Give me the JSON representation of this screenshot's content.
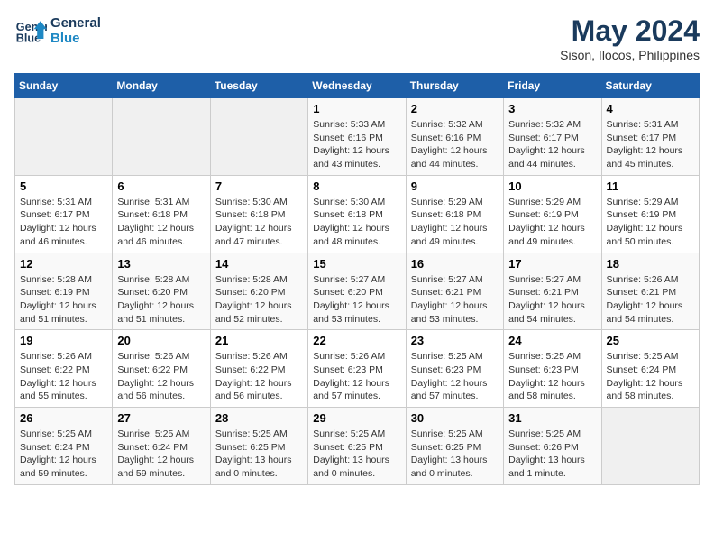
{
  "header": {
    "logo_line1": "General",
    "logo_line2": "Blue",
    "month": "May 2024",
    "location": "Sison, Ilocos, Philippines"
  },
  "weekdays": [
    "Sunday",
    "Monday",
    "Tuesday",
    "Wednesday",
    "Thursday",
    "Friday",
    "Saturday"
  ],
  "weeks": [
    [
      {
        "day": "",
        "info": ""
      },
      {
        "day": "",
        "info": ""
      },
      {
        "day": "",
        "info": ""
      },
      {
        "day": "1",
        "info": "Sunrise: 5:33 AM\nSunset: 6:16 PM\nDaylight: 12 hours\nand 43 minutes."
      },
      {
        "day": "2",
        "info": "Sunrise: 5:32 AM\nSunset: 6:16 PM\nDaylight: 12 hours\nand 44 minutes."
      },
      {
        "day": "3",
        "info": "Sunrise: 5:32 AM\nSunset: 6:17 PM\nDaylight: 12 hours\nand 44 minutes."
      },
      {
        "day": "4",
        "info": "Sunrise: 5:31 AM\nSunset: 6:17 PM\nDaylight: 12 hours\nand 45 minutes."
      }
    ],
    [
      {
        "day": "5",
        "info": "Sunrise: 5:31 AM\nSunset: 6:17 PM\nDaylight: 12 hours\nand 46 minutes."
      },
      {
        "day": "6",
        "info": "Sunrise: 5:31 AM\nSunset: 6:18 PM\nDaylight: 12 hours\nand 46 minutes."
      },
      {
        "day": "7",
        "info": "Sunrise: 5:30 AM\nSunset: 6:18 PM\nDaylight: 12 hours\nand 47 minutes."
      },
      {
        "day": "8",
        "info": "Sunrise: 5:30 AM\nSunset: 6:18 PM\nDaylight: 12 hours\nand 48 minutes."
      },
      {
        "day": "9",
        "info": "Sunrise: 5:29 AM\nSunset: 6:18 PM\nDaylight: 12 hours\nand 49 minutes."
      },
      {
        "day": "10",
        "info": "Sunrise: 5:29 AM\nSunset: 6:19 PM\nDaylight: 12 hours\nand 49 minutes."
      },
      {
        "day": "11",
        "info": "Sunrise: 5:29 AM\nSunset: 6:19 PM\nDaylight: 12 hours\nand 50 minutes."
      }
    ],
    [
      {
        "day": "12",
        "info": "Sunrise: 5:28 AM\nSunset: 6:19 PM\nDaylight: 12 hours\nand 51 minutes."
      },
      {
        "day": "13",
        "info": "Sunrise: 5:28 AM\nSunset: 6:20 PM\nDaylight: 12 hours\nand 51 minutes."
      },
      {
        "day": "14",
        "info": "Sunrise: 5:28 AM\nSunset: 6:20 PM\nDaylight: 12 hours\nand 52 minutes."
      },
      {
        "day": "15",
        "info": "Sunrise: 5:27 AM\nSunset: 6:20 PM\nDaylight: 12 hours\nand 53 minutes."
      },
      {
        "day": "16",
        "info": "Sunrise: 5:27 AM\nSunset: 6:21 PM\nDaylight: 12 hours\nand 53 minutes."
      },
      {
        "day": "17",
        "info": "Sunrise: 5:27 AM\nSunset: 6:21 PM\nDaylight: 12 hours\nand 54 minutes."
      },
      {
        "day": "18",
        "info": "Sunrise: 5:26 AM\nSunset: 6:21 PM\nDaylight: 12 hours\nand 54 minutes."
      }
    ],
    [
      {
        "day": "19",
        "info": "Sunrise: 5:26 AM\nSunset: 6:22 PM\nDaylight: 12 hours\nand 55 minutes."
      },
      {
        "day": "20",
        "info": "Sunrise: 5:26 AM\nSunset: 6:22 PM\nDaylight: 12 hours\nand 56 minutes."
      },
      {
        "day": "21",
        "info": "Sunrise: 5:26 AM\nSunset: 6:22 PM\nDaylight: 12 hours\nand 56 minutes."
      },
      {
        "day": "22",
        "info": "Sunrise: 5:26 AM\nSunset: 6:23 PM\nDaylight: 12 hours\nand 57 minutes."
      },
      {
        "day": "23",
        "info": "Sunrise: 5:25 AM\nSunset: 6:23 PM\nDaylight: 12 hours\nand 57 minutes."
      },
      {
        "day": "24",
        "info": "Sunrise: 5:25 AM\nSunset: 6:23 PM\nDaylight: 12 hours\nand 58 minutes."
      },
      {
        "day": "25",
        "info": "Sunrise: 5:25 AM\nSunset: 6:24 PM\nDaylight: 12 hours\nand 58 minutes."
      }
    ],
    [
      {
        "day": "26",
        "info": "Sunrise: 5:25 AM\nSunset: 6:24 PM\nDaylight: 12 hours\nand 59 minutes."
      },
      {
        "day": "27",
        "info": "Sunrise: 5:25 AM\nSunset: 6:24 PM\nDaylight: 12 hours\nand 59 minutes."
      },
      {
        "day": "28",
        "info": "Sunrise: 5:25 AM\nSunset: 6:25 PM\nDaylight: 13 hours\nand 0 minutes."
      },
      {
        "day": "29",
        "info": "Sunrise: 5:25 AM\nSunset: 6:25 PM\nDaylight: 13 hours\nand 0 minutes."
      },
      {
        "day": "30",
        "info": "Sunrise: 5:25 AM\nSunset: 6:25 PM\nDaylight: 13 hours\nand 0 minutes."
      },
      {
        "day": "31",
        "info": "Sunrise: 5:25 AM\nSunset: 6:26 PM\nDaylight: 13 hours\nand 1 minute."
      },
      {
        "day": "",
        "info": ""
      }
    ]
  ]
}
